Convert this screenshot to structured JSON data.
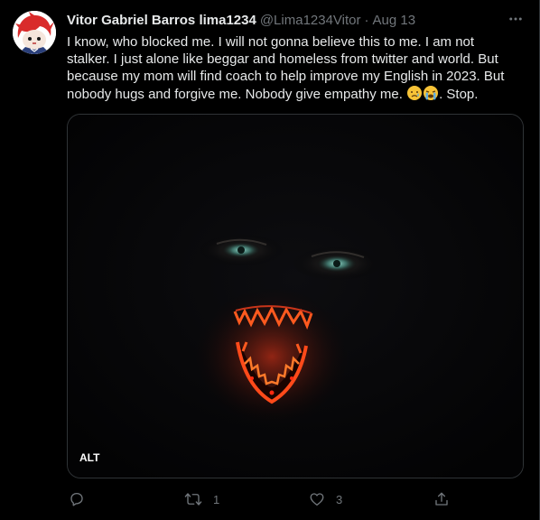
{
  "tweet": {
    "display_name": "Vitor Gabriel Barros lima1234",
    "handle": "@Lima1234Vitor",
    "separator": "·",
    "date": "Aug 13",
    "text_before_emoji": "I know, who blocked me. I will not gonna believe this to me. I am not stalker. I just alone like beggar and homeless from twitter and world. But because my mom will find coach to help improve my English in 2023. But nobody hugs and forgive me. Nobody give empathy me. ",
    "emojis": [
      "crying-face",
      "loudly-crying-face"
    ],
    "text_after_emoji": ". Stop.",
    "media": {
      "alt_label": "ALT"
    },
    "actions": {
      "reply": {
        "icon": "reply-icon",
        "count": ""
      },
      "retweet": {
        "icon": "retweet-icon",
        "count": "1"
      },
      "like": {
        "icon": "heart-icon",
        "count": "3"
      },
      "share": {
        "icon": "share-icon",
        "count": ""
      }
    },
    "more_icon": "more-icon"
  },
  "colors": {
    "background": "#000000",
    "text_primary": "#e7e9ea",
    "text_secondary": "#71767b",
    "border": "#2f3336",
    "avatar_accent": "#d92b2b"
  }
}
